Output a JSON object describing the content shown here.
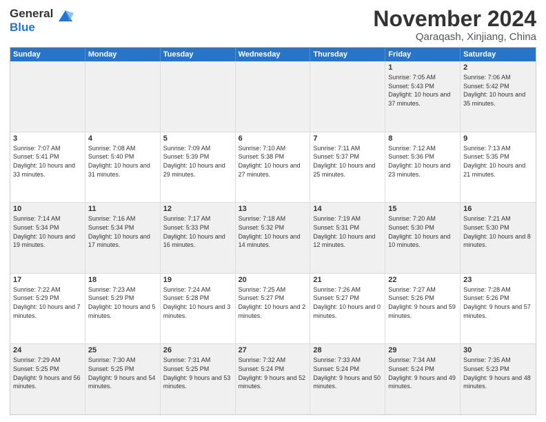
{
  "logo": {
    "line1": "General",
    "line2": "Blue"
  },
  "title": "November 2024",
  "location": "Qaraqash, Xinjiang, China",
  "header_days": [
    "Sunday",
    "Monday",
    "Tuesday",
    "Wednesday",
    "Thursday",
    "Friday",
    "Saturday"
  ],
  "rows": [
    [
      {
        "day": "",
        "info": ""
      },
      {
        "day": "",
        "info": ""
      },
      {
        "day": "",
        "info": ""
      },
      {
        "day": "",
        "info": ""
      },
      {
        "day": "",
        "info": ""
      },
      {
        "day": "1",
        "info": "Sunrise: 7:05 AM\nSunset: 5:43 PM\nDaylight: 10 hours and 37 minutes."
      },
      {
        "day": "2",
        "info": "Sunrise: 7:06 AM\nSunset: 5:42 PM\nDaylight: 10 hours and 35 minutes."
      }
    ],
    [
      {
        "day": "3",
        "info": "Sunrise: 7:07 AM\nSunset: 5:41 PM\nDaylight: 10 hours and 33 minutes."
      },
      {
        "day": "4",
        "info": "Sunrise: 7:08 AM\nSunset: 5:40 PM\nDaylight: 10 hours and 31 minutes."
      },
      {
        "day": "5",
        "info": "Sunrise: 7:09 AM\nSunset: 5:39 PM\nDaylight: 10 hours and 29 minutes."
      },
      {
        "day": "6",
        "info": "Sunrise: 7:10 AM\nSunset: 5:38 PM\nDaylight: 10 hours and 27 minutes."
      },
      {
        "day": "7",
        "info": "Sunrise: 7:11 AM\nSunset: 5:37 PM\nDaylight: 10 hours and 25 minutes."
      },
      {
        "day": "8",
        "info": "Sunrise: 7:12 AM\nSunset: 5:36 PM\nDaylight: 10 hours and 23 minutes."
      },
      {
        "day": "9",
        "info": "Sunrise: 7:13 AM\nSunset: 5:35 PM\nDaylight: 10 hours and 21 minutes."
      }
    ],
    [
      {
        "day": "10",
        "info": "Sunrise: 7:14 AM\nSunset: 5:34 PM\nDaylight: 10 hours and 19 minutes."
      },
      {
        "day": "11",
        "info": "Sunrise: 7:16 AM\nSunset: 5:34 PM\nDaylight: 10 hours and 17 minutes."
      },
      {
        "day": "12",
        "info": "Sunrise: 7:17 AM\nSunset: 5:33 PM\nDaylight: 10 hours and 16 minutes."
      },
      {
        "day": "13",
        "info": "Sunrise: 7:18 AM\nSunset: 5:32 PM\nDaylight: 10 hours and 14 minutes."
      },
      {
        "day": "14",
        "info": "Sunrise: 7:19 AM\nSunset: 5:31 PM\nDaylight: 10 hours and 12 minutes."
      },
      {
        "day": "15",
        "info": "Sunrise: 7:20 AM\nSunset: 5:30 PM\nDaylight: 10 hours and 10 minutes."
      },
      {
        "day": "16",
        "info": "Sunrise: 7:21 AM\nSunset: 5:30 PM\nDaylight: 10 hours and 8 minutes."
      }
    ],
    [
      {
        "day": "17",
        "info": "Sunrise: 7:22 AM\nSunset: 5:29 PM\nDaylight: 10 hours and 7 minutes."
      },
      {
        "day": "18",
        "info": "Sunrise: 7:23 AM\nSunset: 5:29 PM\nDaylight: 10 hours and 5 minutes."
      },
      {
        "day": "19",
        "info": "Sunrise: 7:24 AM\nSunset: 5:28 PM\nDaylight: 10 hours and 3 minutes."
      },
      {
        "day": "20",
        "info": "Sunrise: 7:25 AM\nSunset: 5:27 PM\nDaylight: 10 hours and 2 minutes."
      },
      {
        "day": "21",
        "info": "Sunrise: 7:26 AM\nSunset: 5:27 PM\nDaylight: 10 hours and 0 minutes."
      },
      {
        "day": "22",
        "info": "Sunrise: 7:27 AM\nSunset: 5:26 PM\nDaylight: 9 hours and 59 minutes."
      },
      {
        "day": "23",
        "info": "Sunrise: 7:28 AM\nSunset: 5:26 PM\nDaylight: 9 hours and 57 minutes."
      }
    ],
    [
      {
        "day": "24",
        "info": "Sunrise: 7:29 AM\nSunset: 5:25 PM\nDaylight: 9 hours and 56 minutes."
      },
      {
        "day": "25",
        "info": "Sunrise: 7:30 AM\nSunset: 5:25 PM\nDaylight: 9 hours and 54 minutes."
      },
      {
        "day": "26",
        "info": "Sunrise: 7:31 AM\nSunset: 5:25 PM\nDaylight: 9 hours and 53 minutes."
      },
      {
        "day": "27",
        "info": "Sunrise: 7:32 AM\nSunset: 5:24 PM\nDaylight: 9 hours and 52 minutes."
      },
      {
        "day": "28",
        "info": "Sunrise: 7:33 AM\nSunset: 5:24 PM\nDaylight: 9 hours and 50 minutes."
      },
      {
        "day": "29",
        "info": "Sunrise: 7:34 AM\nSunset: 5:24 PM\nDaylight: 9 hours and 49 minutes."
      },
      {
        "day": "30",
        "info": "Sunrise: 7:35 AM\nSunset: 5:23 PM\nDaylight: 9 hours and 48 minutes."
      }
    ]
  ]
}
